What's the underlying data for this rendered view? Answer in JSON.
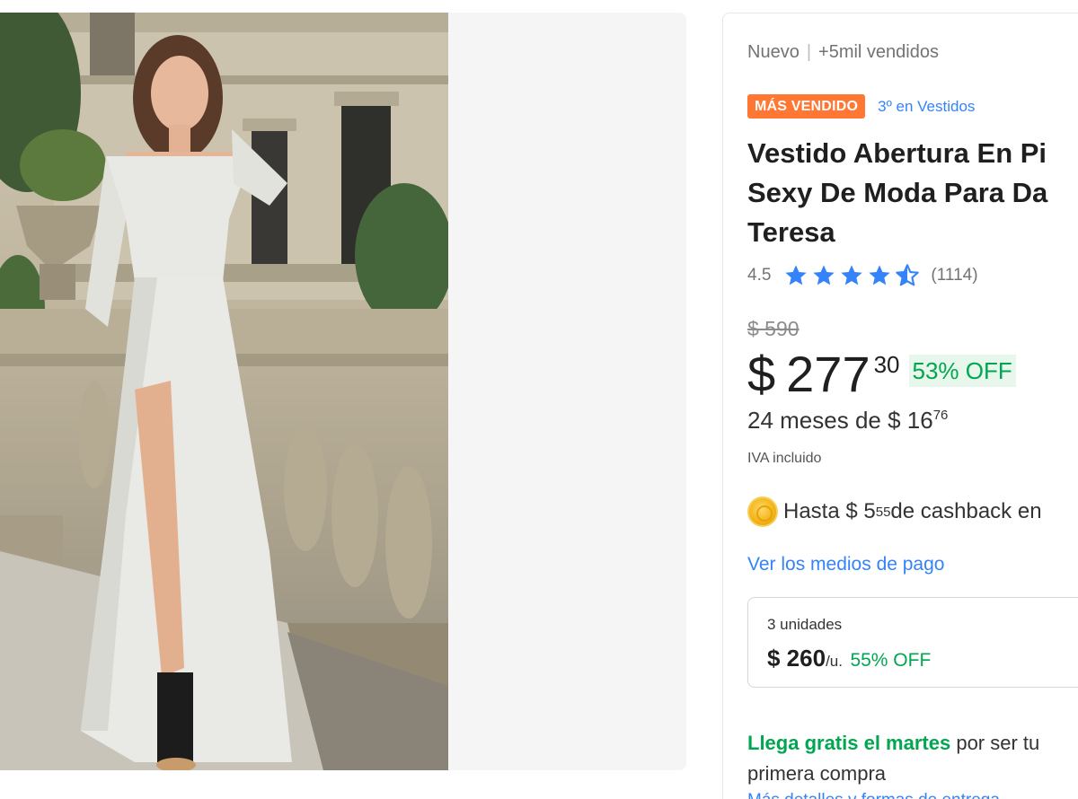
{
  "product": {
    "condition": "Nuevo",
    "sold": "+5mil vendidos",
    "badge": "MÁS VENDIDO",
    "rank": "3º en Vestidos",
    "title": "Vestido Abertura En Pi\nSexy De Moda Para Da\nTeresa",
    "rating": "4.5",
    "rating_value": 4.5,
    "reviews": "(1114)",
    "old_price": "$ 590",
    "price_currency": "$",
    "price_amount": "277",
    "price_cents": "30",
    "discount": "53% OFF",
    "installments_text": "24 meses de $ 16",
    "installments_cents": "76",
    "iva": "IVA incluido",
    "cashback_prefix": "Hasta $ 5",
    "cashback_cents": "55",
    "cashback_suffix": " de cashback en",
    "payment_link": "Ver los medios de pago"
  },
  "bulk": {
    "units": "3 unidades",
    "price": "$ 260",
    "per_unit": "/u.",
    "discount": "55% OFF"
  },
  "shipping": {
    "highlight": "Llega gratis el martes",
    "text": " por ser tu primera compra",
    "more_link": "Más detalles y formas de entrega"
  },
  "colors": {
    "accent_blue": "#3483fa",
    "badge_orange": "#ff7733",
    "green": "#00a650"
  },
  "icons": {
    "star": "star-icon",
    "half_star": "star-half-icon",
    "coin": "coin-icon"
  }
}
